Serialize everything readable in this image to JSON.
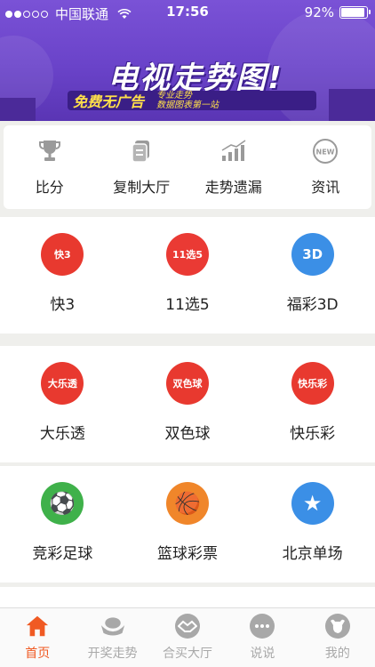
{
  "status": {
    "carrier": "中国联通",
    "time": "17:56",
    "battery": "92%",
    "battery_level": 0.92
  },
  "banner": {
    "title": "电视走势图!",
    "slogan": "免费无广告",
    "tag_line1": "专业走势",
    "tag_line2": "数据图表第一站"
  },
  "quick_menu": [
    {
      "label": "比分",
      "icon": "trophy-icon"
    },
    {
      "label": "复制大厅",
      "icon": "copy-icon"
    },
    {
      "label": "走势遗漏",
      "icon": "trend-bars-icon"
    },
    {
      "label": "资讯",
      "icon": "new-badge-icon"
    }
  ],
  "lottery_rows": [
    [
      {
        "name": "快3",
        "logo": "快3",
        "color": "#e8392f"
      },
      {
        "name": "11选5",
        "logo": "11选5",
        "color": "#ea3a34"
      },
      {
        "name": "福彩3D",
        "logo": "3D",
        "color": "#3b8fe6"
      }
    ],
    [
      {
        "name": "大乐透",
        "logo": "大乐透",
        "color": "#e8392f"
      },
      {
        "name": "双色球",
        "logo": "双色球",
        "color": "#e8392f"
      },
      {
        "name": "快乐彩",
        "logo": "快乐彩",
        "color": "#e8392f"
      }
    ],
    [
      {
        "name": "竞彩足球",
        "logo": "⚽",
        "color": "#3fb14a"
      },
      {
        "name": "篮球彩票",
        "logo": "🏀",
        "color": "#f0862a"
      },
      {
        "name": "北京单场",
        "logo": "★",
        "color": "#3b8fe6"
      }
    ]
  ],
  "tabs": [
    {
      "label": "首页",
      "icon": "home-icon",
      "active": true
    },
    {
      "label": "开奖走势",
      "icon": "ingot-icon",
      "active": false
    },
    {
      "label": "合买大厅",
      "icon": "handshake-icon",
      "active": false
    },
    {
      "label": "说说",
      "icon": "chat-bubble-icon",
      "active": false
    },
    {
      "label": "我的",
      "icon": "profile-icon",
      "active": false
    }
  ],
  "colors": {
    "accent": "#f05a23",
    "banner": "#6a43c9"
  }
}
